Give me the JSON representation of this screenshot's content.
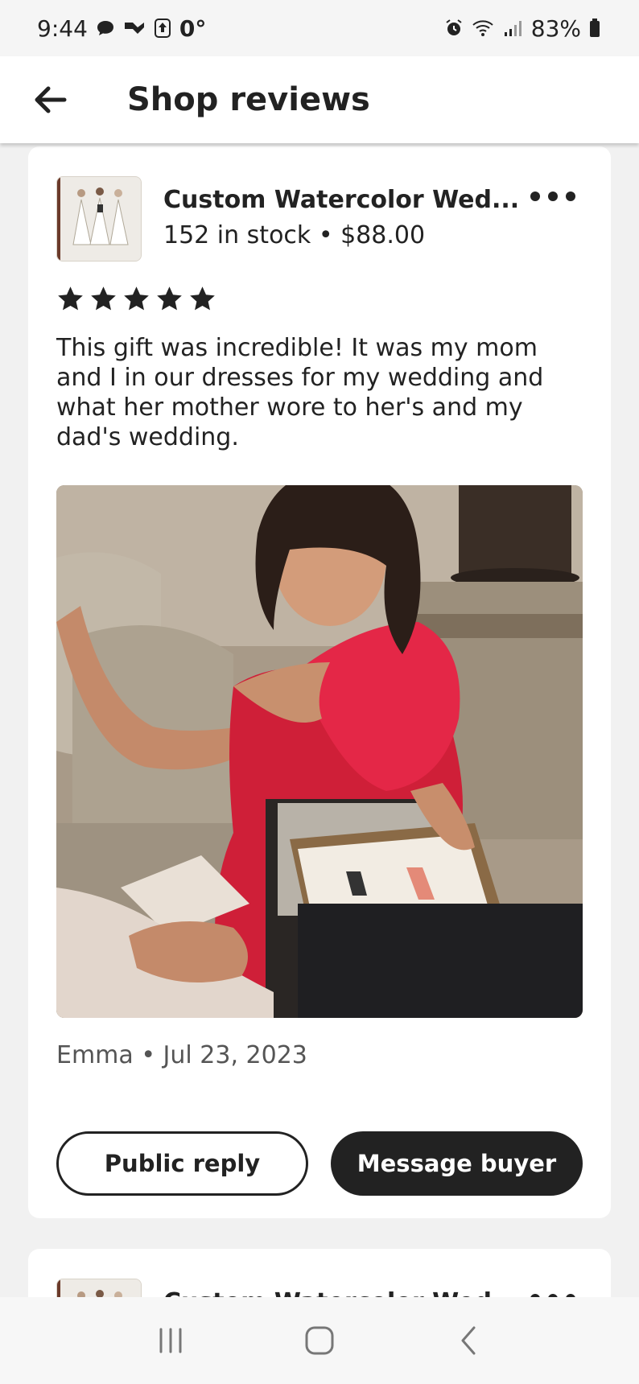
{
  "status_bar": {
    "time": "9:44",
    "temperature": "0°",
    "battery": "83%",
    "icons_left": [
      "chat-bubble-icon",
      "flag-icon",
      "upload-icon"
    ],
    "icons_right": [
      "alarm-icon",
      "wifi-icon",
      "signal-icon",
      "battery-icon"
    ]
  },
  "app_bar": {
    "title": "Shop reviews",
    "back_icon": "arrow-left-icon"
  },
  "reviews": [
    {
      "listing": {
        "title": "Custom Watercolor Wed...",
        "meta": "152 in stock • $88.00"
      },
      "rating": 5,
      "text": "This gift was incredible! It was my mom and I in our dresses for my wedding and what her mother wore to her's and my dad's wedding.",
      "author_date": "Emma • Jul 23, 2023",
      "actions": {
        "public_reply": "Public reply",
        "message_buyer": "Message buyer"
      }
    },
    {
      "listing": {
        "title": "Custom Watercolor Wed..."
      }
    }
  ],
  "colors": {
    "page_bg": "#f1f1f1",
    "card_bg": "#ffffff",
    "text": "#222222",
    "muted_text": "#555555",
    "primary_button_bg": "#222222"
  },
  "nav_bar": {
    "icons": [
      "recent-apps-icon",
      "home-icon",
      "back-icon"
    ]
  }
}
